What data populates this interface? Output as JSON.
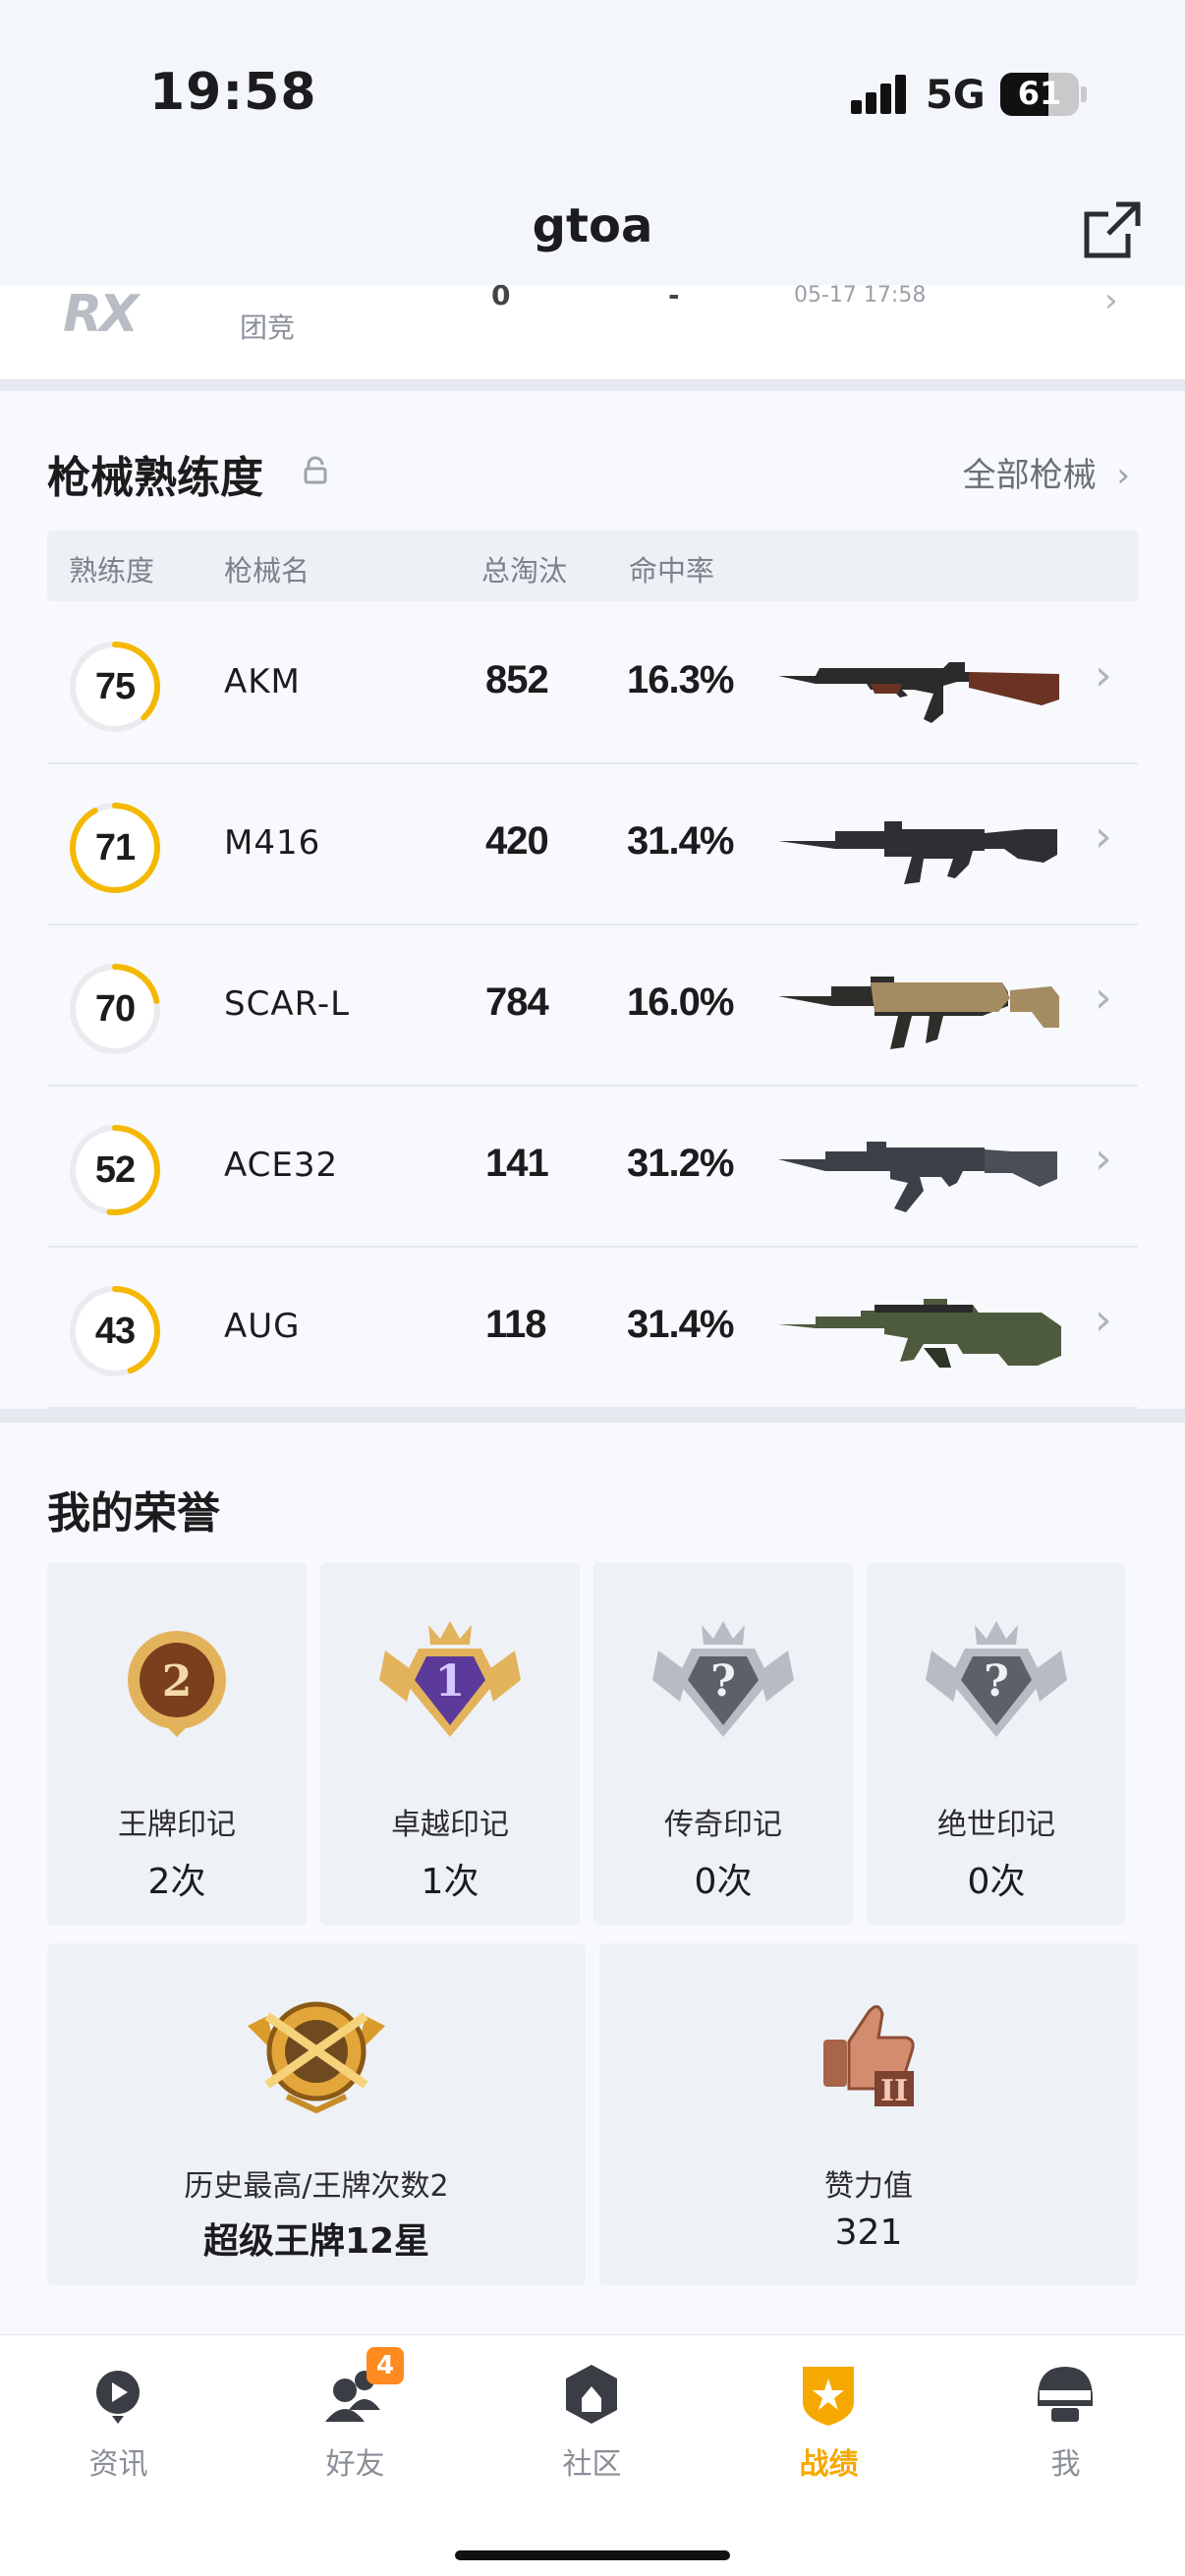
{
  "status_bar": {
    "time": "19:58",
    "network": "5G",
    "battery": "61",
    "battery_level": 0.61
  },
  "header": {
    "title": "gtoa",
    "share_icon": "share-external-icon"
  },
  "recent_match": {
    "logo_text": "RX",
    "mode": "团竞",
    "value1": "0",
    "value2": "-",
    "datetime": "05-17 17:58"
  },
  "weapons": {
    "title": "枪械熟练度",
    "lock_icon": "lock-icon",
    "all_link": "全部枪械",
    "columns": {
      "proficiency": "熟练度",
      "name": "枪械名",
      "kills": "总淘汰",
      "accuracy": "命中率"
    },
    "ring_color": "#f5b800",
    "rows": [
      {
        "level": "75",
        "progress": 0.38,
        "name": "AKM",
        "kills": "852",
        "accuracy": "16.3%",
        "gun_icon": "akm-rifle-icon"
      },
      {
        "level": "71",
        "progress": 0.92,
        "name": "M416",
        "kills": "420",
        "accuracy": "31.4%",
        "gun_icon": "m416-rifle-icon"
      },
      {
        "level": "70",
        "progress": 0.22,
        "name": "SCAR-L",
        "kills": "784",
        "accuracy": "16.0%",
        "gun_icon": "scarl-rifle-icon"
      },
      {
        "level": "52",
        "progress": 0.52,
        "name": "ACE32",
        "kills": "141",
        "accuracy": "31.2%",
        "gun_icon": "ace32-rifle-icon"
      },
      {
        "level": "43",
        "progress": 0.44,
        "name": "AUG",
        "kills": "118",
        "accuracy": "31.4%",
        "gun_icon": "aug-rifle-icon"
      }
    ]
  },
  "honors": {
    "title": "我的荣誉",
    "marks": [
      {
        "label": "王牌印记",
        "count": "2次",
        "badge_text": "2",
        "icon": "ace-mark-icon"
      },
      {
        "label": "卓越印记",
        "count": "1次",
        "badge_text": "1",
        "icon": "excellent-mark-icon"
      },
      {
        "label": "传奇印记",
        "count": "0次",
        "badge_text": "?",
        "icon": "legend-mark-icon"
      },
      {
        "label": "绝世印记",
        "count": "0次",
        "badge_text": "?",
        "icon": "peerless-mark-icon"
      }
    ],
    "highest": {
      "label": "历史最高/王牌次数2",
      "value": "超级王牌12星",
      "icon": "super-ace-rank-icon"
    },
    "likes": {
      "label": "赞力值",
      "value": "321",
      "icon": "thumbs-up-trophy-icon"
    }
  },
  "tabbar": {
    "active_color": "#f5a800",
    "tabs": [
      {
        "label": "资讯",
        "icon": "news-icon"
      },
      {
        "label": "好友",
        "icon": "friends-icon",
        "badge": "4"
      },
      {
        "label": "社区",
        "icon": "community-icon"
      },
      {
        "label": "战绩",
        "icon": "stats-icon",
        "active": true
      },
      {
        "label": "我",
        "icon": "profile-helmet-icon"
      }
    ]
  }
}
